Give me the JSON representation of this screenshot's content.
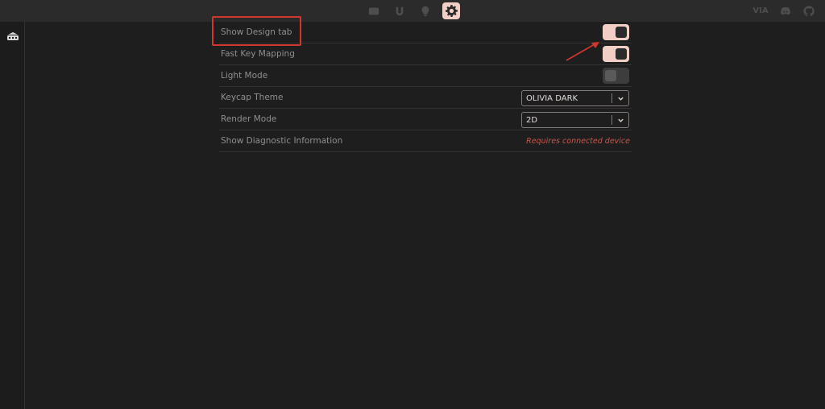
{
  "topbar": {
    "icons": [
      "keyboard-icon",
      "remap-icon",
      "lighting-icon",
      "settings-icon"
    ],
    "right_icons": [
      "via-logo-icon",
      "discord-icon",
      "github-icon"
    ],
    "via_text": "VIA"
  },
  "sidebar": {
    "icon": "keyboard-icon"
  },
  "settings": {
    "rows": [
      {
        "label": "Show Design tab",
        "control": "toggle",
        "state": "on"
      },
      {
        "label": "Fast Key Mapping",
        "control": "toggle",
        "state": "on"
      },
      {
        "label": "Light Mode",
        "control": "toggle",
        "state": "off"
      },
      {
        "label": "Keycap Theme",
        "control": "select",
        "value": "OLIVIA DARK"
      },
      {
        "label": "Render Mode",
        "control": "select",
        "value": "2D"
      },
      {
        "label": "Show Diagnostic Information",
        "control": "note",
        "note": "Requires connected device"
      }
    ]
  },
  "colors": {
    "accent": "#f1cfc6",
    "background": "#1f1e1e",
    "annotation": "#d1362f",
    "warning_text": "#c6574e"
  }
}
